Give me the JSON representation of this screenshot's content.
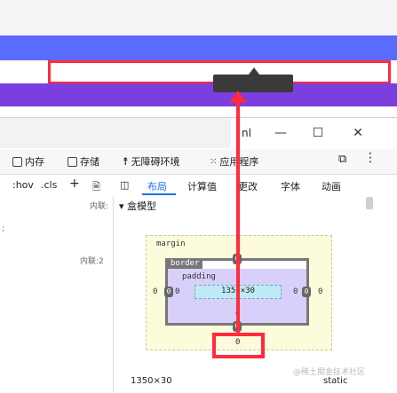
{
  "devtools": {
    "title_fragment": "nl",
    "tabs": [
      "内存",
      "存储",
      "无障碍环境",
      "应用程序"
    ],
    "toolbar": {
      "hov": ":hov",
      "cls": ".cls",
      "add": "+",
      "subtabs": [
        "布局",
        "计算值",
        "更改",
        "字体",
        "动画"
      ]
    },
    "left_pane": {
      "rule1": "内联:",
      "rule2": "内联:2",
      "semicolon": ";"
    },
    "section_title": "盒模型",
    "box_model": {
      "margin_label": "margin",
      "border_label": "border",
      "padding_label": "padding",
      "content_size": "1350×30",
      "margin_left": "0",
      "margin_right": "0",
      "margin_bottom": "0",
      "border_top": "0",
      "border_left": "0",
      "border_right": "0",
      "border_bottom": "0",
      "padding_left": "0",
      "padding_right": "0",
      "padding_bottom": "0"
    },
    "footer": {
      "size": "1350×30",
      "position": "static"
    },
    "watermark": "@稀土掘金技术社区"
  }
}
